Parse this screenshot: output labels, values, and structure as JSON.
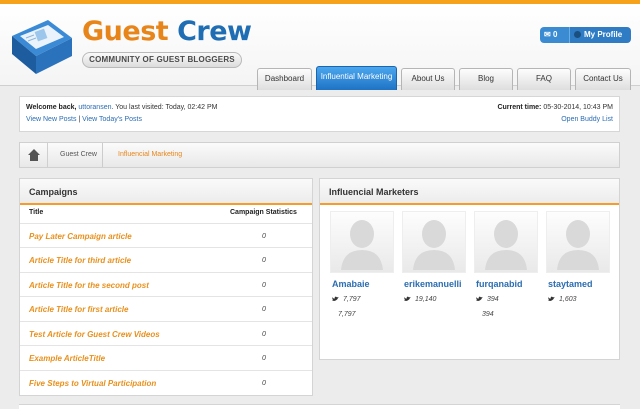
{
  "brand": {
    "word1": "Guest",
    "word2": "Crew",
    "tagline": "COMMUNITY OF GUEST BLOGGERS",
    "orange": "#e8851a",
    "blue": "#1f6db3"
  },
  "header": {
    "notif_count": "0",
    "profile_label": "My Profile"
  },
  "nav": {
    "tabs": [
      {
        "label": "Dashboard"
      },
      {
        "label": "Influential Marketing",
        "active": true
      },
      {
        "label": "About Us"
      },
      {
        "label": "Blog"
      },
      {
        "label": "FAQ"
      },
      {
        "label": "Contact Us"
      }
    ]
  },
  "welcome": {
    "prefix": "Welcome back, ",
    "username": "uttoransen",
    "last_visited": ". You last visited: Today, 02:42 PM",
    "view_new": "View New Posts",
    "sep": " | ",
    "view_today": "View Today's Posts",
    "current_time_label": "Current time:",
    "current_time": " 05-30-2014, 10:43 PM",
    "buddy_list": "Open Buddy List"
  },
  "breadcrumb": {
    "items": [
      "Guest Crew",
      "Influencial Marketing"
    ]
  },
  "campaigns": {
    "title": "Campaigns",
    "col_title": "Title",
    "col_stats": "Campaign Statistics",
    "rows": [
      {
        "title": "Pay Later Campaign article",
        "value": "0"
      },
      {
        "title": "Article Title for third article",
        "value": "0"
      },
      {
        "title": "Article Title for the second post",
        "value": "0"
      },
      {
        "title": "Article Title for first article",
        "value": "0"
      },
      {
        "title": "Test Article for Guest Crew Videos",
        "value": "0"
      },
      {
        "title": "Example ArticleTitle",
        "value": "0"
      },
      {
        "title": "Five Steps to Virtual Participation",
        "value": "0"
      }
    ]
  },
  "marketers": {
    "title": "Influencial Marketers",
    "items": [
      {
        "name": "Amabaie",
        "followers": "7,797",
        "followers2": "7,797"
      },
      {
        "name": "erikemanuelli",
        "followers": "19,140",
        "followers2": ""
      },
      {
        "name": "furqanabid",
        "followers": "394",
        "followers2": "394"
      },
      {
        "name": "staytamed",
        "followers": "1,603",
        "followers2": ""
      }
    ]
  }
}
